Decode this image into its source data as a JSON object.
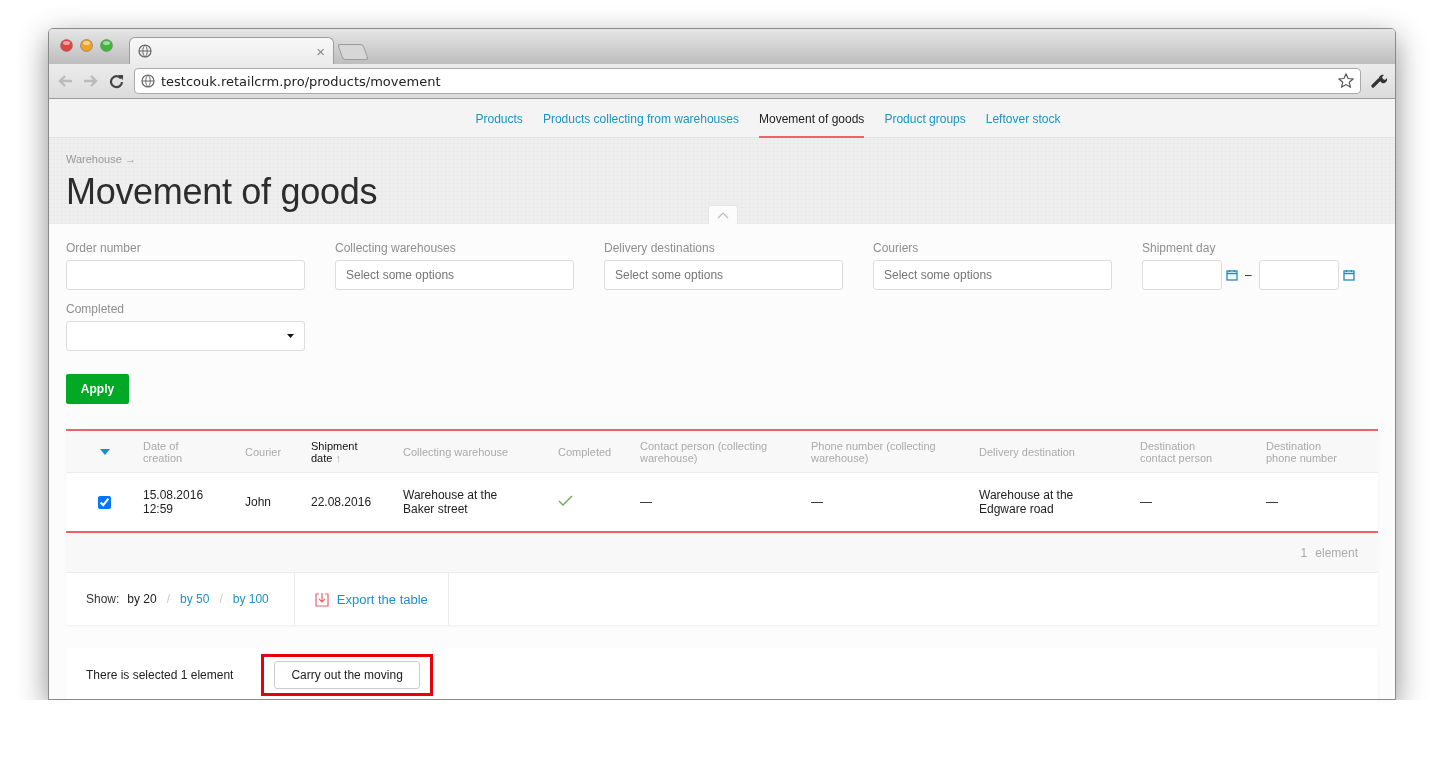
{
  "browser": {
    "url": "testcouk.retailcrm.pro/products/movement",
    "tab_close": "×"
  },
  "nav": [
    {
      "label": "Products",
      "selected": false
    },
    {
      "label": "Products collecting from warehouses",
      "selected": false
    },
    {
      "label": "Movement of goods",
      "selected": true
    },
    {
      "label": "Product groups",
      "selected": false
    },
    {
      "label": "Leftover stock",
      "selected": false
    }
  ],
  "breadcrumb": "Warehouse →",
  "title": "Movement of goods",
  "filters": [
    {
      "kind": "text",
      "label": "Order number"
    },
    {
      "kind": "multiselect",
      "label": "Collecting warehouses",
      "placeholder": "Select some options"
    },
    {
      "kind": "multiselect",
      "label": "Delivery destinations",
      "placeholder": "Select some options"
    },
    {
      "kind": "multiselect",
      "label": "Couriers",
      "placeholder": "Select some options"
    },
    {
      "kind": "daterange",
      "label": "Shipment day",
      "separator": "–"
    },
    {
      "kind": "select",
      "label": "Completed"
    }
  ],
  "apply": "Apply",
  "table": {
    "columns": [
      {
        "label": "Date of creation",
        "sorted": false
      },
      {
        "label": "Courier",
        "sorted": false
      },
      {
        "label": "Shipment date",
        "sorted": true,
        "sort_mark": "↑"
      },
      {
        "label": "Collecting warehouse",
        "sorted": false
      },
      {
        "label": "Completed",
        "sorted": false
      },
      {
        "label": "Contact person (collecting warehouse)",
        "sorted": false
      },
      {
        "label": "Phone number (collecting warehouse)",
        "sorted": false
      },
      {
        "label": "Delivery destination",
        "sorted": false
      },
      {
        "label": "Destination contact person",
        "sorted": false
      },
      {
        "label": "Destination phone number",
        "sorted": false
      }
    ],
    "rows": [
      {
        "selected": true,
        "cells": [
          {
            "kind": "text",
            "text": "15.08.2016 12:59"
          },
          {
            "kind": "text",
            "text": "John"
          },
          {
            "kind": "text",
            "text": "22.08.2016"
          },
          {
            "kind": "text",
            "text": "Warehouse at the Baker street"
          },
          {
            "kind": "check",
            "checked": true
          },
          {
            "kind": "text",
            "text": "—"
          },
          {
            "kind": "text",
            "text": "—"
          },
          {
            "kind": "text",
            "text": "Warehouse at the Edgware road"
          },
          {
            "kind": "text",
            "text": "—"
          },
          {
            "kind": "text",
            "text": "—"
          }
        ]
      }
    ],
    "count": "1",
    "count_label": "element"
  },
  "page_size": {
    "label": "Show:",
    "separator": "/",
    "options": [
      {
        "label": "by 20",
        "selected": true
      },
      {
        "label": "by 50",
        "selected": false
      },
      {
        "label": "by 100",
        "selected": false
      }
    ]
  },
  "export": "Export the table",
  "selection_bar": {
    "text": "There is selected 1 element",
    "button": "Carry out the moving",
    "highlighted": true
  }
}
